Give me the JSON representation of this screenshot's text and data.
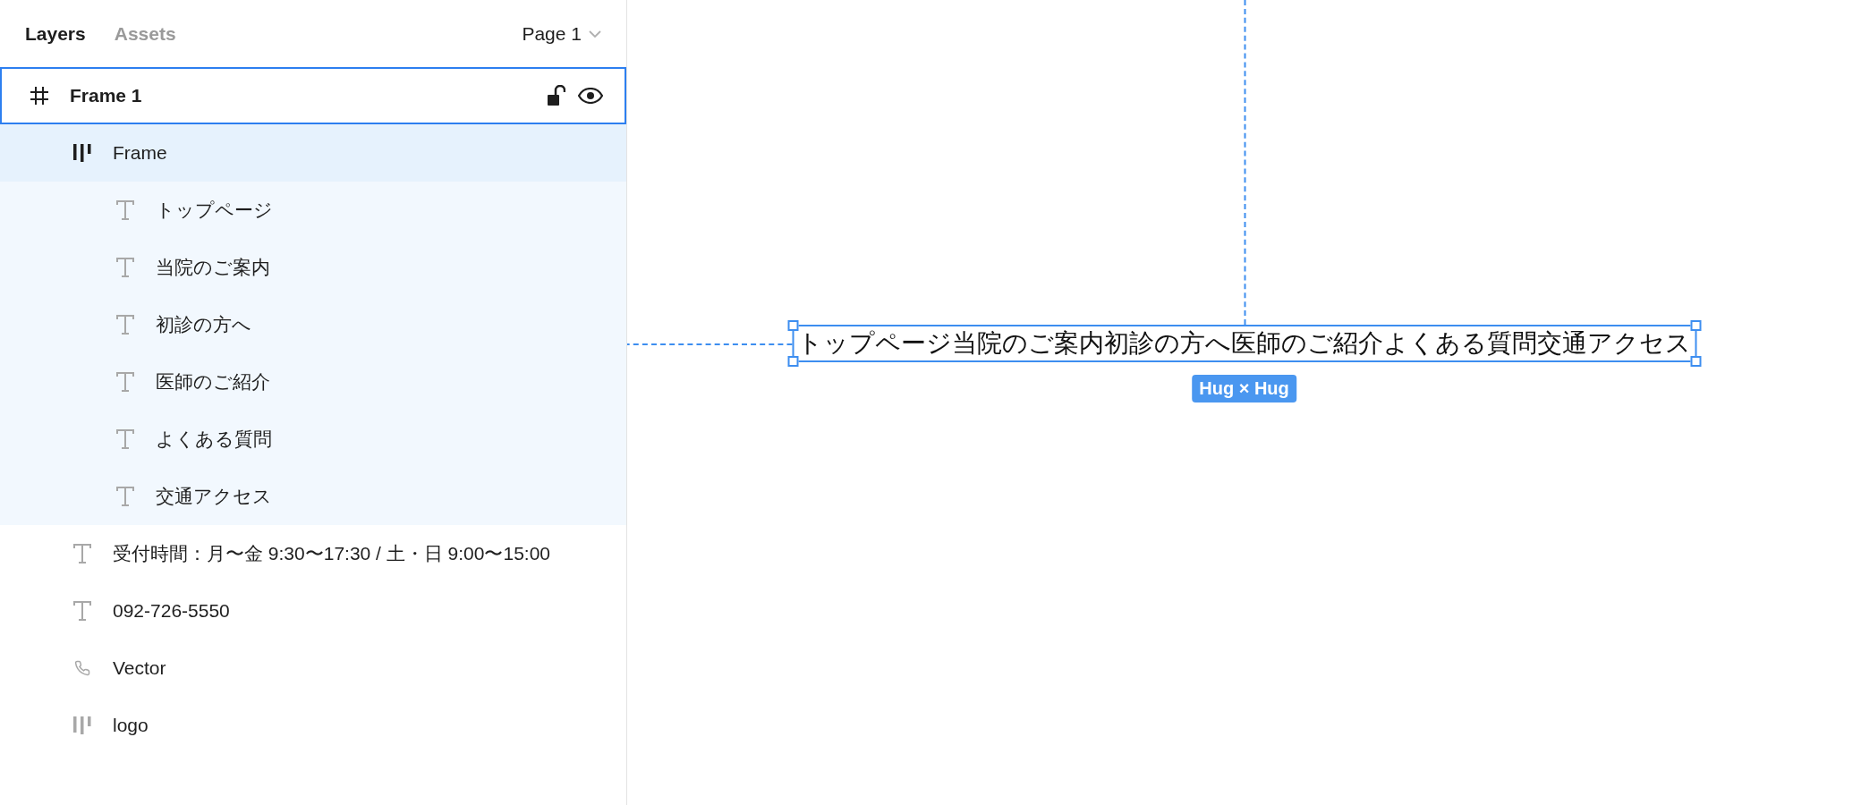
{
  "tabs": [
    {
      "label": "Layers",
      "selected": true
    },
    {
      "label": "Assets",
      "selected": false
    }
  ],
  "page_selector": {
    "label": "Page 1"
  },
  "layers": [
    {
      "name": "Frame 1",
      "kind": "frame",
      "selected": false,
      "hovered": true,
      "children": [
        {
          "name": "Frame",
          "kind": "autolayout",
          "selected": true,
          "hovered": false,
          "children": [
            {
              "name": "トップページ",
              "kind": "text",
              "selected": false,
              "hovered": false
            },
            {
              "name": "当院のご案内",
              "kind": "text",
              "selected": false,
              "hovered": false
            },
            {
              "name": "初診の方へ",
              "kind": "text",
              "selected": false,
              "hovered": false
            },
            {
              "name": "医師のご紹介",
              "kind": "text",
              "selected": false,
              "hovered": false
            },
            {
              "name": "よくある質問",
              "kind": "text",
              "selected": false,
              "hovered": false
            },
            {
              "name": "交通アクセス",
              "kind": "text",
              "selected": false,
              "hovered": false
            }
          ]
        },
        {
          "name": "受付時間：月〜金 9:30〜17:30 / 土・日 9:00〜15:00",
          "kind": "text",
          "selected": false,
          "hovered": false
        },
        {
          "name": "092-726-5550",
          "kind": "text",
          "selected": false,
          "hovered": false
        },
        {
          "name": "Vector",
          "kind": "vector",
          "selected": false,
          "hovered": false
        },
        {
          "name": "logo",
          "kind": "autolayout",
          "selected": false,
          "hovered": false
        }
      ]
    }
  ],
  "canvas": {
    "selected_text": "トップページ当院のご案内初診の方へ医師のご紹介よくある質問交通アクセス",
    "size_badge": "Hug × Hug"
  }
}
